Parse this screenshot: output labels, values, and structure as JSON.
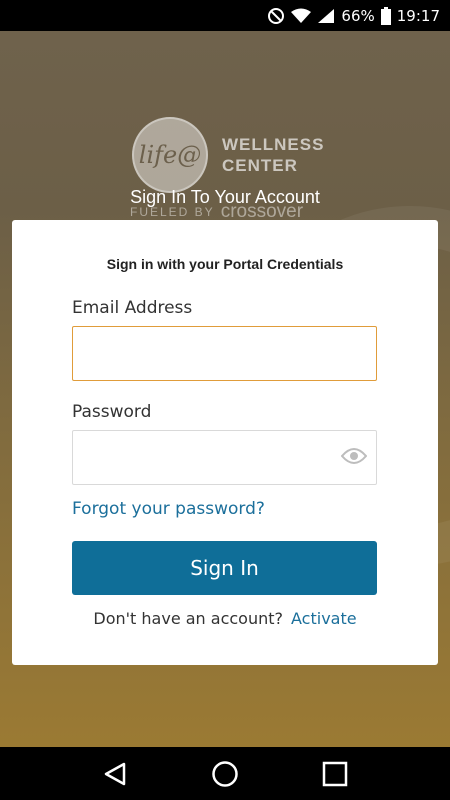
{
  "status_bar": {
    "battery_percent": "66%",
    "time": "19:17",
    "icons": [
      "do-not-disturb-icon",
      "wifi-icon",
      "signal-icon",
      "battery-icon"
    ]
  },
  "logo": {
    "mark": "life@",
    "line1": "WELLNESS",
    "line2": "CENTER",
    "powered_by": "FUELED BY",
    "brand": "crossover"
  },
  "page_heading": "Sign In To Your Account",
  "card": {
    "title": "Sign in with your Portal Credentials",
    "email_label": "Email Address",
    "email_value": "",
    "password_label": "Password",
    "password_value": "",
    "forgot_link": "Forgot your password?",
    "signin_button": "Sign In",
    "no_account_text": "Don't have an account?",
    "activate_link": "Activate"
  },
  "nav_bar": {
    "icons": [
      "back-icon",
      "home-icon",
      "recents-icon"
    ]
  },
  "colors": {
    "primary_button": "#0f6e98",
    "link": "#1b6f9b",
    "focus_border": "#e09c3a"
  }
}
